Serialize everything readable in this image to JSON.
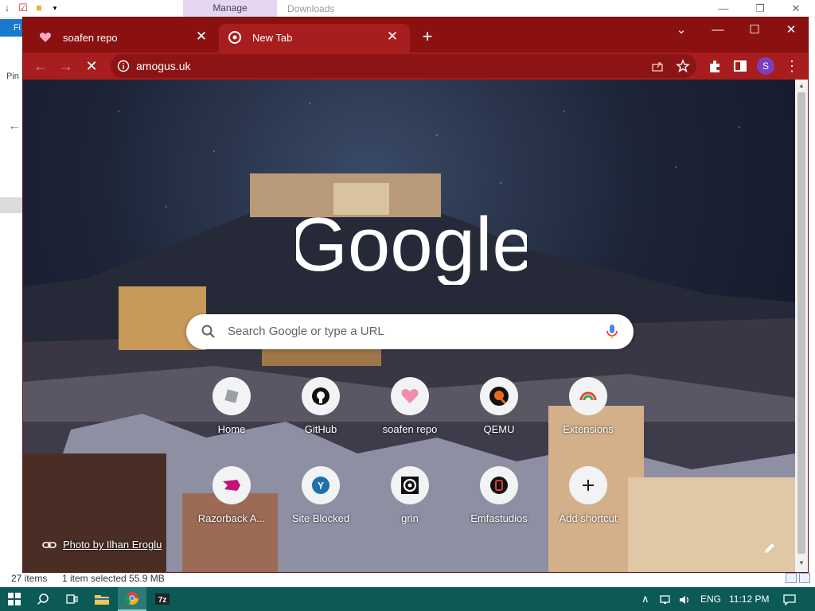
{
  "explorer": {
    "manage_label": "Manage",
    "downloads_label": "Downloads",
    "ribbon_tab": "Fi",
    "pin_label": "Pin",
    "status_items": "27 items",
    "status_selected": "1 item selected  55.9 MB",
    "winctl": [
      "—",
      "❐",
      "✕"
    ]
  },
  "chrome": {
    "tabs": [
      {
        "title": "soafen repo",
        "close": "✕"
      },
      {
        "title": "New Tab",
        "close": "✕"
      }
    ],
    "newtab_glyph": "+",
    "window_controls": [
      "⌄",
      "—",
      "☐",
      "✕"
    ],
    "toolbar": {
      "back": "←",
      "forward": "→",
      "stop": "✕",
      "url": "amogus.uk",
      "avatar_letter": "S",
      "menu": "⋮"
    },
    "accent_color": "#a81d1d",
    "tabstrip_color": "#8b1111"
  },
  "ntp": {
    "logo_text": "Google",
    "search_placeholder": "Search Google or type a URL",
    "shortcuts": [
      {
        "label": "Home",
        "icon": "roblox-icon"
      },
      {
        "label": "GitHub",
        "icon": "github-icon"
      },
      {
        "label": "soafen repo",
        "icon": "heart-icon"
      },
      {
        "label": "QEMU",
        "icon": "qemu-icon"
      },
      {
        "label": "Extensions",
        "icon": "chrome-rainbow-icon"
      },
      {
        "label": "Razorback A...",
        "icon": "razorback-icon"
      },
      {
        "label": "Site Blocked",
        "icon": "y-icon"
      },
      {
        "label": "grin",
        "icon": "grin-icon"
      },
      {
        "label": "Emfastudios",
        "icon": "emfastudios-icon"
      },
      {
        "label": "Add shortcut",
        "icon": "plus-icon"
      }
    ],
    "photo_credit": "Photo by Ilhan Eroglu"
  },
  "taskbar": {
    "language": "ENG",
    "time": "11:12 PM"
  }
}
